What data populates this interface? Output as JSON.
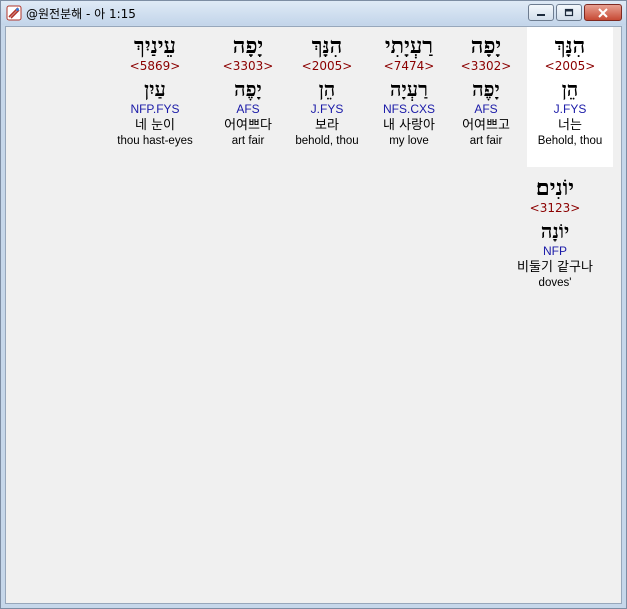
{
  "window": {
    "title": "@원전분해 - 아 1:15",
    "icon": "app-icon",
    "buttons": {
      "minimize": "minimize-icon",
      "maximize": "maximize-icon",
      "close": "close-icon"
    }
  },
  "words": [
    {
      "hebrew": "הִנָּךְ",
      "strong": "<2005>",
      "lemma": "הֵן",
      "morph": "J.FYS",
      "korean": "너는",
      "english": "Behold, thou",
      "highlighted": true
    },
    {
      "hebrew": "יָפָה",
      "strong": "<3302>",
      "lemma": "יָפֶה",
      "morph": "AFS",
      "korean": "어여쁘고",
      "english": "art fair"
    },
    {
      "hebrew": "רַעְיָתִי",
      "strong": "<7474>",
      "lemma": "רַעְיָה",
      "morph": "NFS.CXS",
      "korean": "내 사랑아",
      "english": "my love"
    },
    {
      "hebrew": "הִנָּךְ",
      "strong": "<2005>",
      "lemma": "הֵן",
      "morph": "J.FYS",
      "korean": "보라",
      "english": "behold, thou"
    },
    {
      "hebrew": "יָפָה",
      "strong": "<3303>",
      "lemma": "יָפֶה",
      "morph": "AFS",
      "korean": "어여쁘다",
      "english": "art fair"
    },
    {
      "hebrew": "עֵינַיִךְ",
      "strong": "<5869>",
      "lemma": "עַיִן",
      "morph": "NFP.FYS",
      "korean": "네 눈이",
      "english": "thou hast-eyes"
    },
    {
      "hebrew": "יוֹנִים׃",
      "strong": "<3123>",
      "lemma": "יוֹנָה",
      "morph": "NFP",
      "korean": "비둘기 같구나",
      "english": "doves'"
    }
  ]
}
